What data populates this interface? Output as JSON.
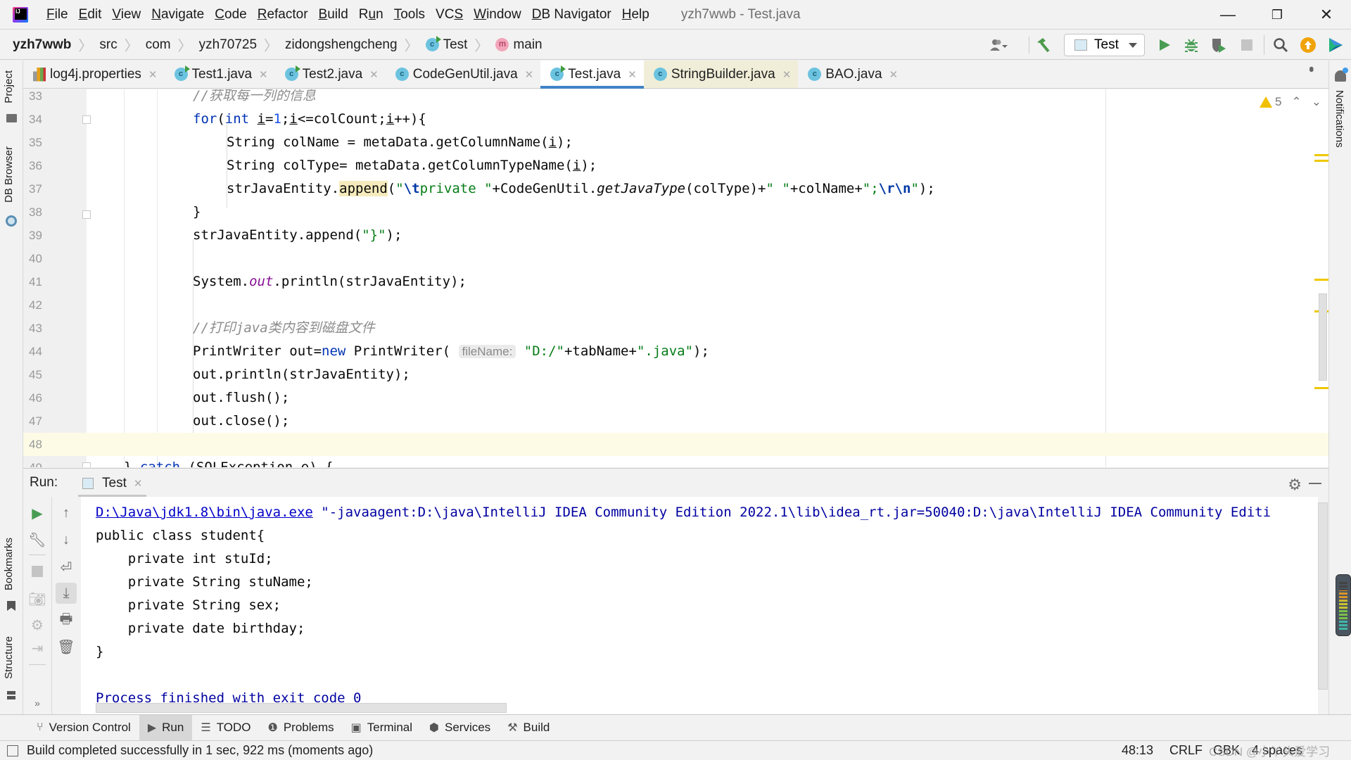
{
  "window": {
    "title": "yzh7wwb - Test.java",
    "controls": {
      "minimize": "—",
      "restore": "❐",
      "close": "✕"
    }
  },
  "menu": [
    {
      "label": "File",
      "mnemonic": "F",
      "rest": "ile"
    },
    {
      "label": "Edit",
      "mnemonic": "E",
      "rest": "dit"
    },
    {
      "label": "View",
      "mnemonic": "V",
      "rest": "iew"
    },
    {
      "label": "Navigate",
      "mnemonic": "N",
      "rest": "avigate"
    },
    {
      "label": "Code",
      "mnemonic": "C",
      "rest": "ode"
    },
    {
      "label": "Refactor",
      "mnemonic": "R",
      "rest": "efactor"
    },
    {
      "label": "Build",
      "mnemonic": "B",
      "rest": "uild"
    },
    {
      "label": "Run",
      "pre": "R",
      "mnemonic": "u",
      "rest": "n"
    },
    {
      "label": "Tools",
      "mnemonic": "T",
      "rest": "ools"
    },
    {
      "label": "VCS",
      "pre": "VC",
      "mnemonic": "S",
      "rest": ""
    },
    {
      "label": "Window",
      "mnemonic": "W",
      "rest": "indow"
    },
    {
      "label": "DB Navigator",
      "mnemonic": "D",
      "rest": "B Navigator"
    },
    {
      "label": "Help",
      "mnemonic": "H",
      "rest": "elp"
    }
  ],
  "breadcrumb": [
    "yzh7wwb",
    "src",
    "com",
    "yzh70725",
    "zidongshengcheng",
    "Test",
    "main"
  ],
  "run_config": {
    "selected": "Test"
  },
  "toolbar_icons": [
    "vcs-user-icon",
    "build-hammer-icon",
    "run-icon",
    "debug-icon",
    "coverage-icon",
    "stop-icon",
    "search-icon",
    "update-icon",
    "plugin-icon"
  ],
  "left_tools": {
    "top": [
      "Project",
      "DB Browser"
    ],
    "bottom": [
      "Bookmarks",
      "Structure"
    ]
  },
  "right_tools": [
    "Notifications"
  ],
  "tabs": [
    {
      "label": "log4j.properties",
      "icon": "properties-file-icon",
      "state": ""
    },
    {
      "label": "Test1.java",
      "icon": "runnable-class-icon",
      "state": ""
    },
    {
      "label": "Test2.java",
      "icon": "runnable-class-icon",
      "state": ""
    },
    {
      "label": "CodeGenUtil.java",
      "icon": "class-icon",
      "state": ""
    },
    {
      "label": "Test.java",
      "icon": "runnable-class-icon",
      "state": "active"
    },
    {
      "label": "StringBuilder.java",
      "icon": "class-icon",
      "state": "readonly"
    },
    {
      "label": "BAO.java",
      "icon": "class-icon",
      "state": ""
    }
  ],
  "editor": {
    "inspection": {
      "warnings": "5"
    },
    "lines": [
      {
        "n": "33",
        "tokens": [
          [
            "cmt",
            "//获取每一列的信息"
          ]
        ],
        "indent": 2
      },
      {
        "n": "34",
        "tokens": [
          [
            "kw",
            "for"
          ],
          [
            "",
            "("
          ],
          [
            "kw",
            "int "
          ],
          [
            "ul",
            "i"
          ],
          [
            "",
            "="
          ],
          [
            "num",
            "1"
          ],
          [
            "",
            ";"
          ],
          [
            "ul",
            "i"
          ],
          [
            "",
            "<=colCount;"
          ],
          [
            "ul",
            "i"
          ],
          [
            "",
            "++){"
          ]
        ],
        "indent": 2
      },
      {
        "n": "35",
        "tokens": [
          [
            "",
            "String colName = metaData.getColumnName("
          ],
          [
            "ul",
            "i"
          ],
          [
            "",
            ");"
          ]
        ],
        "indent": 3
      },
      {
        "n": "36",
        "tokens": [
          [
            "",
            "String colType= metaData.getColumnTypeName("
          ],
          [
            "ul",
            "i"
          ],
          [
            "",
            ");"
          ]
        ],
        "indent": 3
      },
      {
        "n": "37",
        "tokens": [
          [
            "",
            "strJavaEntity."
          ],
          [
            "hl",
            "append"
          ],
          [
            "",
            "("
          ],
          [
            "str",
            "\""
          ],
          [
            "esc",
            "\\t"
          ],
          [
            "str",
            "private \""
          ],
          [
            "",
            "+CodeGenUtil."
          ],
          [
            "italic",
            "getJavaType"
          ],
          [
            "",
            "(colType)+"
          ],
          [
            "str",
            "\" \""
          ],
          [
            "",
            "+colName+"
          ],
          [
            "str",
            "\";"
          ],
          [
            "esc",
            "\\r\\n"
          ],
          [
            "str",
            "\""
          ],
          [
            "",
            ");"
          ]
        ],
        "indent": 3
      },
      {
        "n": "38",
        "tokens": [
          [
            "",
            "}"
          ]
        ],
        "indent": 2
      },
      {
        "n": "39",
        "tokens": [
          [
            "",
            "strJavaEntity.append("
          ],
          [
            "str",
            "\"}\""
          ],
          [
            "",
            ");"
          ]
        ],
        "indent": 2
      },
      {
        "n": "40",
        "tokens": [],
        "indent": 2
      },
      {
        "n": "41",
        "tokens": [
          [
            "",
            "System."
          ],
          [
            "static",
            "out"
          ],
          [
            "",
            ".println(strJavaEntity);"
          ]
        ],
        "indent": 2
      },
      {
        "n": "42",
        "tokens": [],
        "indent": 2
      },
      {
        "n": "43",
        "tokens": [
          [
            "cmt",
            "//打印java类内容到磁盘文件"
          ]
        ],
        "indent": 2
      },
      {
        "n": "44",
        "tokens": [
          [
            "",
            "PrintWriter out="
          ],
          [
            "kw",
            "new"
          ],
          [
            "",
            " PrintWriter( "
          ],
          [
            "hint",
            "fileName:"
          ],
          [
            "",
            " "
          ],
          [
            "str",
            "\"D:/\""
          ],
          [
            "",
            "+tabName+"
          ],
          [
            "str",
            "\".java\""
          ],
          [
            "",
            ");"
          ]
        ],
        "indent": 2
      },
      {
        "n": "45",
        "tokens": [
          [
            "",
            "out.println(strJavaEntity);"
          ]
        ],
        "indent": 2
      },
      {
        "n": "46",
        "tokens": [
          [
            "",
            "out.flush();"
          ]
        ],
        "indent": 2
      },
      {
        "n": "47",
        "tokens": [
          [
            "",
            "out.close();"
          ]
        ],
        "indent": 2
      },
      {
        "n": "48",
        "tokens": [],
        "indent": 2,
        "current": true
      },
      {
        "n": "49",
        "tokens": [
          [
            "",
            "} "
          ],
          [
            "kw",
            "catch"
          ],
          [
            "",
            " (SQLException e) {"
          ]
        ],
        "indent": 1
      }
    ],
    "caret": "48:13"
  },
  "run_panel": {
    "label": "Run:",
    "tab": "Test",
    "console": [
      {
        "type": "sys",
        "link": "D:\\Java\\jdk1.8\\bin\\java.exe",
        "text": " \"-javaagent:D:\\java\\IntelliJ IDEA Community Edition 2022.1\\lib\\idea_rt.jar=50040:D:\\java\\IntelliJ IDEA Community Editi"
      },
      {
        "type": "out",
        "text": "public class student{"
      },
      {
        "type": "out",
        "text": "    private int stuId;"
      },
      {
        "type": "out",
        "text": "    private String stuName;"
      },
      {
        "type": "out",
        "text": "    private String sex;"
      },
      {
        "type": "out",
        "text": "    private date birthday;"
      },
      {
        "type": "out",
        "text": "}"
      },
      {
        "type": "out",
        "text": ""
      },
      {
        "type": "sys",
        "text": "Process finished with exit code 0"
      }
    ]
  },
  "bottom_tools": [
    {
      "label": "Version Control",
      "icon": "version-control-icon",
      "glyph": "⑂"
    },
    {
      "label": "Run",
      "icon": "run-icon",
      "glyph": "▶",
      "active": true
    },
    {
      "label": "TODO",
      "icon": "todo-list-icon",
      "glyph": "☰"
    },
    {
      "label": "Problems",
      "icon": "problems-icon",
      "glyph": "❶"
    },
    {
      "label": "Terminal",
      "icon": "terminal-icon",
      "glyph": "▣"
    },
    {
      "label": "Services",
      "icon": "services-icon",
      "glyph": "⬢"
    },
    {
      "label": "Build",
      "icon": "build-hammer-icon",
      "glyph": "⚒"
    }
  ],
  "status": {
    "message": "Build completed successfully in 1 sec, 922 ms (moments ago)",
    "position": "48:13",
    "line_separator": "CRLF",
    "encoding": "GBK",
    "indent": "4 spaces"
  },
  "watermark": "CSDN @小丫头爱学习",
  "colors": {
    "accent": "#4083c9",
    "keyword": "#0033b3",
    "string": "#067d17",
    "warning": "#f0c000",
    "run_green": "#499c54"
  }
}
